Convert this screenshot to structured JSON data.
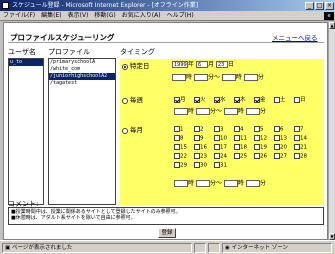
{
  "window": {
    "title": "スケジュール登録 - Microsoft Internet Explorer - [オフライン作業]"
  },
  "menu": [
    "ファイル(F)",
    "編集(E)",
    "表示(V)",
    "移動(G)",
    "お気に入り(A)",
    "ヘルプ(H)"
  ],
  "page": {
    "title": "プロファイルスケジューリング",
    "back_link": "メニューへ戻る"
  },
  "columns": {
    "user": "ユーザ名",
    "profile": "プロファイル",
    "timing": "タイミング"
  },
  "users": [
    {
      "label": "u_to",
      "selected": true
    }
  ],
  "profiles": [
    {
      "label": "/primaryschoolA",
      "selected": false
    },
    {
      "label": "/white_com",
      "selected": false
    },
    {
      "label": "/juniorhighschoolA2",
      "selected": true
    },
    {
      "label": "/tagatest",
      "selected": false
    }
  ],
  "timing": {
    "specific_date": {
      "label": "特定日",
      "selected": true,
      "year": "1999",
      "year_unit": "年",
      "month": "6",
      "month_unit": "月",
      "day": "23",
      "day_unit": "日",
      "hour1": "",
      "min1": "",
      "hour2": "",
      "min2": "",
      "hour_unit": "時",
      "min_unit": "分",
      "range_sep": "〜"
    },
    "weekly": {
      "label": "毎週",
      "selected": false,
      "days": [
        {
          "label": "月",
          "checked": true
        },
        {
          "label": "火",
          "checked": true
        },
        {
          "label": "水",
          "checked": true
        },
        {
          "label": "木",
          "checked": true
        },
        {
          "label": "金",
          "checked": true
        },
        {
          "label": "土",
          "checked": false
        },
        {
          "label": "日",
          "checked": false
        }
      ]
    },
    "monthly": {
      "label": "毎月",
      "selected": false,
      "dates": [
        "1",
        "2",
        "3",
        "4",
        "5",
        "6",
        "7",
        "8",
        "9",
        "10",
        "11",
        "12",
        "13",
        "14",
        "15",
        "16",
        "17",
        "18",
        "19",
        "20",
        "21",
        "22",
        "23",
        "24",
        "25",
        "26",
        "27",
        "28",
        "29",
        "30",
        "31"
      ]
    }
  },
  "comment": {
    "label": "コメント:",
    "lines": [
      "■授業時間中は、授業に関係あるサイトとして登録したサイトのみ参照可。",
      "■休憩時は、アダルト系サイトを除いて自由に参照可。"
    ]
  },
  "submit_label": "登録",
  "status": {
    "left": "ページが表示されました",
    "right": "インターネット ゾーン"
  }
}
